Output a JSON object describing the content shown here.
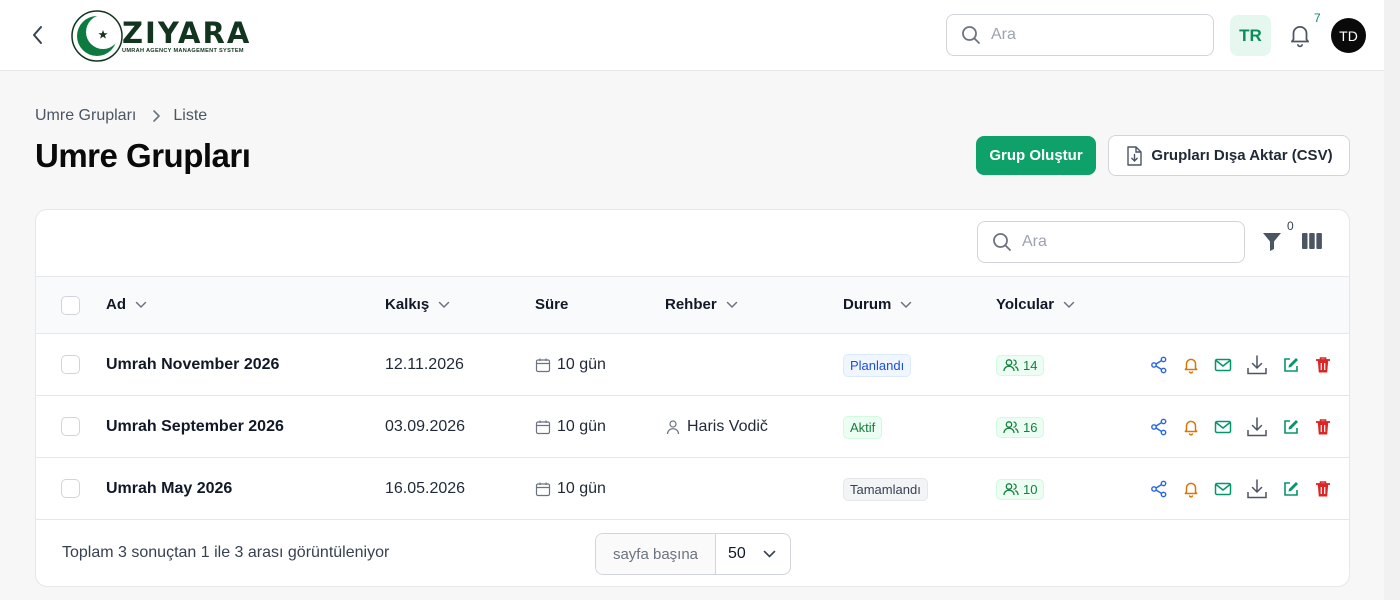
{
  "topbar": {
    "logo_word": "ZIYARA",
    "logo_tagline": "UMRAH AGENCY MANAGEMENT SYSTEM",
    "search_placeholder": "Ara",
    "language": "TR",
    "notification_count": "7",
    "avatar_initials": "TD"
  },
  "breadcrumb": {
    "parent": "Umre Grupları",
    "current": "Liste"
  },
  "page_title": "Umre Grupları",
  "buttons": {
    "create": "Grup Oluştur",
    "export": "Grupları Dışa Aktar (CSV)"
  },
  "table": {
    "search_placeholder": "Ara",
    "filter_count": "0",
    "columns": {
      "name": "Ad",
      "departure": "Kalkış",
      "duration": "Süre",
      "guide": "Rehber",
      "status": "Durum",
      "passengers": "Yolcular"
    },
    "rows": [
      {
        "name": "Umrah November 2026",
        "departure": "12.11.2026",
        "duration": "10 gün",
        "guide": "",
        "status": "Planlandı",
        "passengers": "14"
      },
      {
        "name": "Umrah September 2026",
        "departure": "03.09.2026",
        "duration": "10 gün",
        "guide": "Haris Vodič",
        "status": "Aktif",
        "passengers": "16"
      },
      {
        "name": "Umrah May 2026",
        "departure": "16.05.2026",
        "duration": "10 gün",
        "guide": "",
        "status": "Tamamlandı",
        "passengers": "10"
      }
    ],
    "footer_summary": "Toplam 3 sonuçtan 1 ile 3 arası görüntüleniyor",
    "per_page_label": "sayfa başına",
    "per_page_value": "50"
  },
  "colors": {
    "brand": "#0ea26a",
    "brand_dark": "#12351f",
    "share": "#2563eb",
    "bell": "#d97706",
    "mail": "#059669",
    "delete": "#dc2626"
  },
  "icons": [
    "chevron-left-icon",
    "search-icon",
    "bell-icon",
    "file-download-icon",
    "filter-icon",
    "columns-icon",
    "calendar-icon",
    "user-icon",
    "users-icon",
    "share-icon",
    "mail-icon",
    "download-icon",
    "edit-icon",
    "trash-icon"
  ]
}
